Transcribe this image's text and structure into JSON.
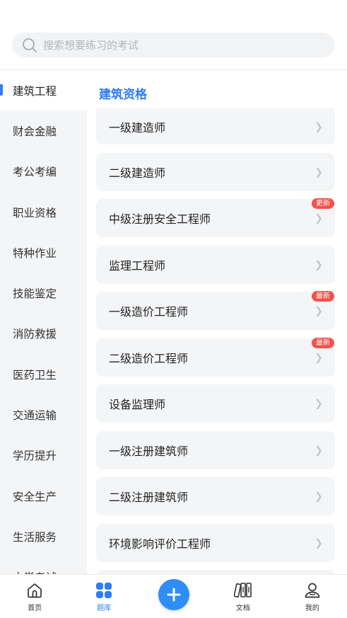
{
  "search": {
    "placeholder": "搜索想要练习的考试"
  },
  "sidebar": {
    "items": [
      {
        "label": "建筑工程",
        "active": true
      },
      {
        "label": "财会金融",
        "active": false
      },
      {
        "label": "考公考编",
        "active": false
      },
      {
        "label": "职业资格",
        "active": false
      },
      {
        "label": "特种作业",
        "active": false
      },
      {
        "label": "技能鉴定",
        "active": false
      },
      {
        "label": "消防救援",
        "active": false
      },
      {
        "label": "医药卫生",
        "active": false
      },
      {
        "label": "交通运输",
        "active": false
      },
      {
        "label": "学历提升",
        "active": false
      },
      {
        "label": "安全生产",
        "active": false
      },
      {
        "label": "生活服务",
        "active": false
      },
      {
        "label": "大学考试",
        "active": false
      }
    ]
  },
  "content": {
    "section_title": "建筑资格",
    "cards": [
      {
        "label": "一级建造师",
        "badge": ""
      },
      {
        "label": "二级建造师",
        "badge": ""
      },
      {
        "label": "中级注册安全工程师",
        "badge": "更新"
      },
      {
        "label": "监理工程师",
        "badge": ""
      },
      {
        "label": "一级造价工程师",
        "badge": "最新"
      },
      {
        "label": "二级造价工程师",
        "badge": "最新"
      },
      {
        "label": "设备监理师",
        "badge": ""
      },
      {
        "label": "一级注册建筑师",
        "badge": ""
      },
      {
        "label": "二级注册建筑师",
        "badge": ""
      },
      {
        "label": "环境影响评价工程师",
        "badge": ""
      },
      {
        "label": "",
        "badge": ""
      }
    ]
  },
  "tabbar": {
    "home": "首页",
    "bank": "题库",
    "docs": "文档",
    "mine": "我的"
  },
  "colors": {
    "accent": "#2f7cf6",
    "badge": "#f4514b",
    "sidebar_bg": "#f4f5f7"
  }
}
